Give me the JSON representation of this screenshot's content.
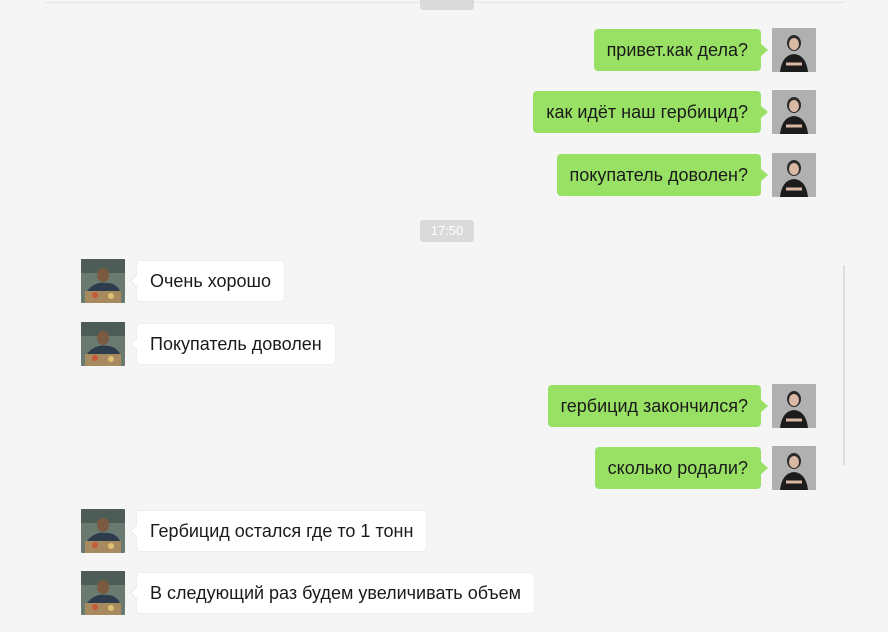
{
  "chat": {
    "timestamps": [
      "17:50"
    ],
    "messages": [
      {
        "side": "sent",
        "text": "привет.как дела?"
      },
      {
        "side": "sent",
        "text": "как идёт наш гербицид?"
      },
      {
        "side": "sent",
        "text": "покупатель доволен?"
      },
      {
        "side": "recv",
        "text": "Очень хорошо"
      },
      {
        "side": "recv",
        "text": "Покупатель доволен"
      },
      {
        "side": "sent",
        "text": "гербицид закончился?"
      },
      {
        "side": "sent",
        "text": "сколько родали?"
      },
      {
        "side": "recv",
        "text": "Гербицид остался где то 1 тонн"
      },
      {
        "side": "recv",
        "text": "В следующий раз будем увеличивать объем"
      }
    ]
  },
  "colors": {
    "background": "#f5f5f5",
    "sent_bubble": "#98e165",
    "received_bubble": "#ffffff",
    "timestamp_bg": "#dadada"
  },
  "icons": {
    "sent_avatar": "user-avatar-woman",
    "received_avatar": "contact-avatar-man"
  }
}
